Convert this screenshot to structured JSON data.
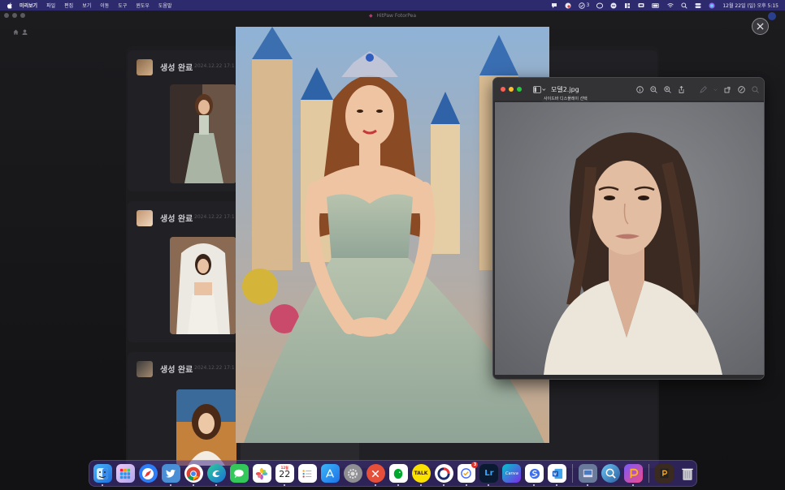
{
  "menubar": {
    "app_name": "미리보기",
    "items": [
      "파일",
      "편집",
      "보기",
      "이동",
      "도구",
      "윈도우",
      "도움말"
    ],
    "status_badge_count": "3",
    "clock": "12월 22일 (일) 오후 5:15"
  },
  "app": {
    "title": "HitPaw FotorPea",
    "cards": [
      {
        "label": "생성 완료",
        "date": "2024.12.22 17:1"
      },
      {
        "label": "생성 완료",
        "date": "2024.12.22 17:1"
      },
      {
        "label": "생성 완료",
        "date": "2024.12.22 17:1"
      }
    ]
  },
  "preview": {
    "filename": "모델2.jpg",
    "tooltip": "사이드바 디스플레이 선택"
  },
  "dock": {
    "calendar_month": "12월",
    "calendar_day": "22",
    "kakao_label": "TALK",
    "lightroom_label": "Lr",
    "canva_label": "Canva",
    "badge_count": "3"
  },
  "colors": {
    "menubar": "#2e2a6e",
    "dock": "#46328c",
    "close_red": "#ff5f57",
    "min_yellow": "#febc2e",
    "max_green": "#28c840"
  }
}
